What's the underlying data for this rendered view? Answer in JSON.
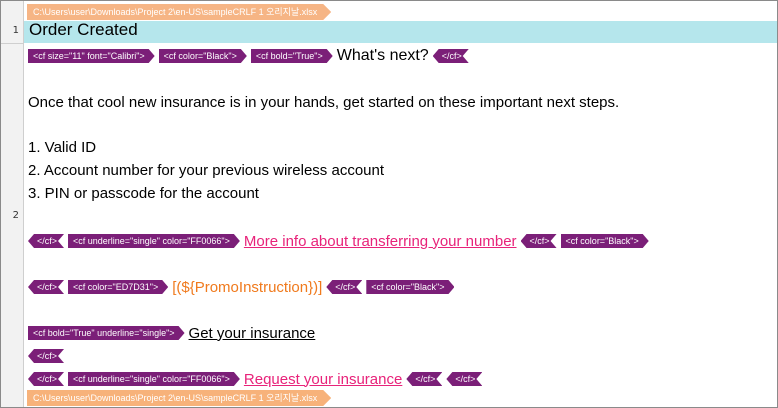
{
  "file_path": "C:\\Users\\user\\Downloads\\Project 2\\en-US\\sampleCRLF 1 오리지날.xlsx",
  "rows": [
    {
      "num": "1",
      "text": "Order Created"
    },
    {
      "num": "2"
    }
  ],
  "content": {
    "tags": {
      "cf_size_font": "<cf size=\"11\" font=\"Calibri\">",
      "cf_color_black": "<cf color=\"Black\">",
      "cf_bold": "<cf bold=\"True\">",
      "cf_close": "</cf>",
      "cf_underline_ff": "<cf underline=\"single\" color=\"FF0066\">",
      "cf_color_orange": "<cf color=\"ED7D31\">",
      "cf_bold_underline": "<cf bold=\"True\" underline=\"single\">"
    },
    "whats_next": "What's next?",
    "intro": "Once that cool new insurance is in your hands, get started on these important next steps.",
    "list": [
      "1. Valid ID",
      "2. Account number for your previous wireless account",
      "3. PIN or passcode for the account"
    ],
    "more_info": "More info about transferring your number",
    "promo": "[(${PromoInstruction})]",
    "get_insurance": "Get your insurance",
    "request_insurance": "Request your insurance"
  }
}
